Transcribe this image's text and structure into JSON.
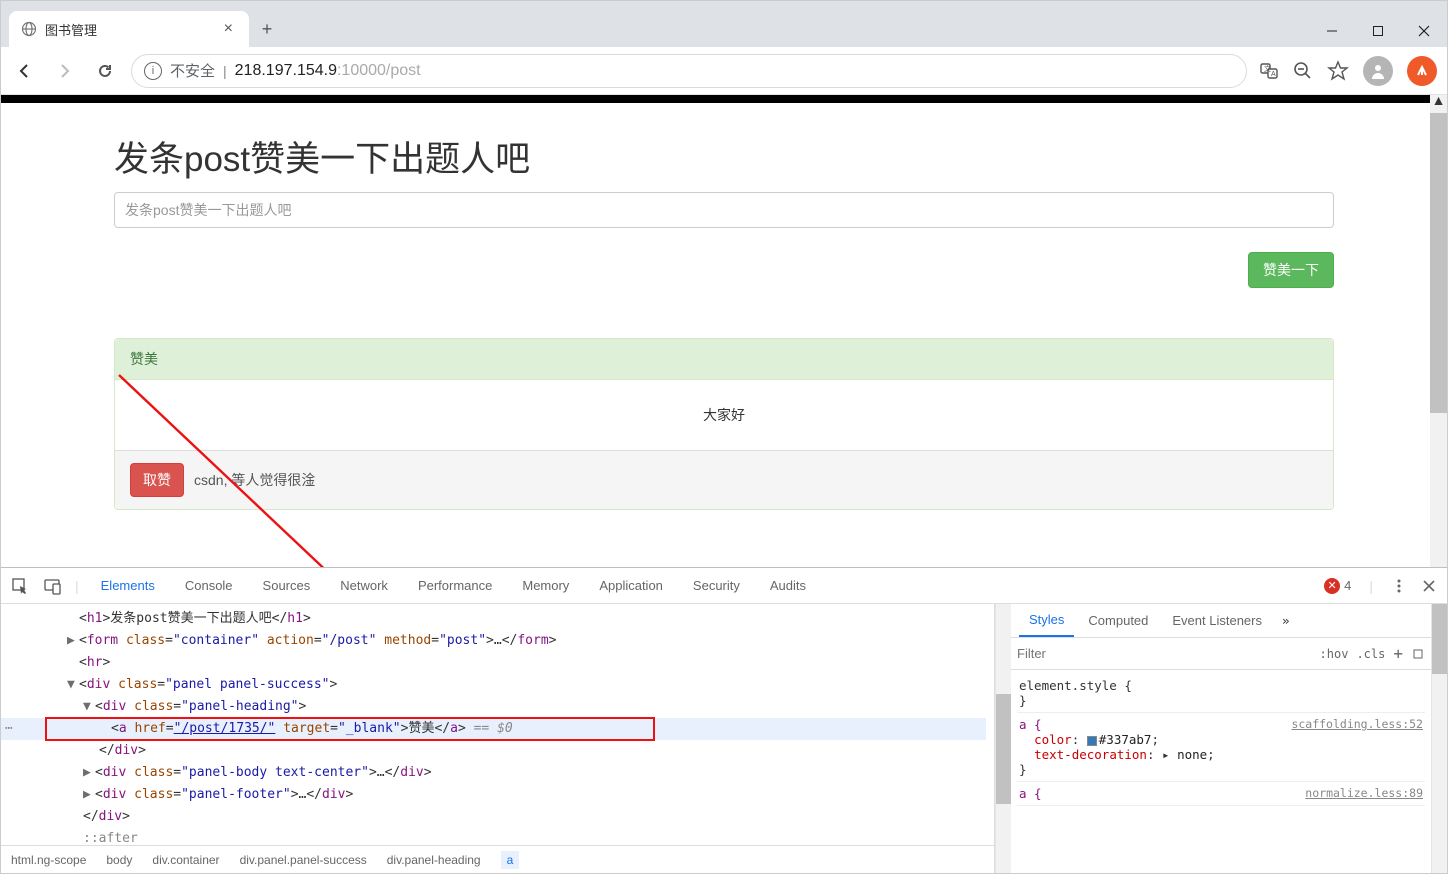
{
  "titlebar": {
    "tab_title": "图书管理"
  },
  "urlbar": {
    "insecure": "不安全",
    "host": "218.197.154.9",
    "port_path": ":10000/post"
  },
  "page": {
    "heading": "发条post赞美一下出题人吧",
    "input_placeholder": "发条post赞美一下出题人吧",
    "submit": "赞美一下",
    "panel_link": "赞美",
    "panel_body": "大家好",
    "unlike": "取赞",
    "footer_text": "csdn, 等人觉得很淦"
  },
  "devtools": {
    "tabs": [
      "Elements",
      "Console",
      "Sources",
      "Network",
      "Performance",
      "Memory",
      "Application",
      "Security",
      "Audits"
    ],
    "errors": "4",
    "right_tabs": [
      "Styles",
      "Computed",
      "Event Listeners"
    ],
    "filter": "Filter",
    "hov": ":hov",
    "cls": ".cls",
    "rule1": "element.style {",
    "rule2_sel": "a {",
    "rule2_link": "scaffolding.less:52",
    "rule2_p1": "color",
    "rule2_v1": "#337ab7",
    "rule2_p2": "text-decoration",
    "rule2_v2": "none",
    "rule3_sel": "a {",
    "rule3_link": "normalize.less:89",
    "breadcrumb": [
      "html.ng-scope",
      "body",
      "div.container",
      "div.panel.panel-success",
      "div.panel-heading",
      "a"
    ],
    "dom": {
      "l0": "<h1>发条post赞美一下出题人吧</h1>",
      "l1_a": "<form ",
      "l1_class": "class",
      "l1_classv": "\"container\"",
      "l1_action": "action",
      "l1_actionv": "\"/post\"",
      "l1_method": "method",
      "l1_methodv": "\"post\"",
      "l1_b": ">…</form>",
      "l2": "<hr>",
      "l3a": "<div ",
      "l3cv": "\"panel panel-success\"",
      "l4cv": "\"panel-heading\"",
      "l5a": "<a ",
      "l5href": "href",
      "l5hrefv": "\"/post/1735/\"",
      "l5target": "target",
      "l5targetv": "\"_blank\"",
      "l5text": "赞美",
      "l5close": "</a>",
      "l5eq": " == $0",
      "l6": "</div>",
      "l7cv": "\"panel-body text-center\"",
      "l8cv": "\"panel-footer\"",
      "l9": "</div>",
      "l10": "::after"
    }
  }
}
